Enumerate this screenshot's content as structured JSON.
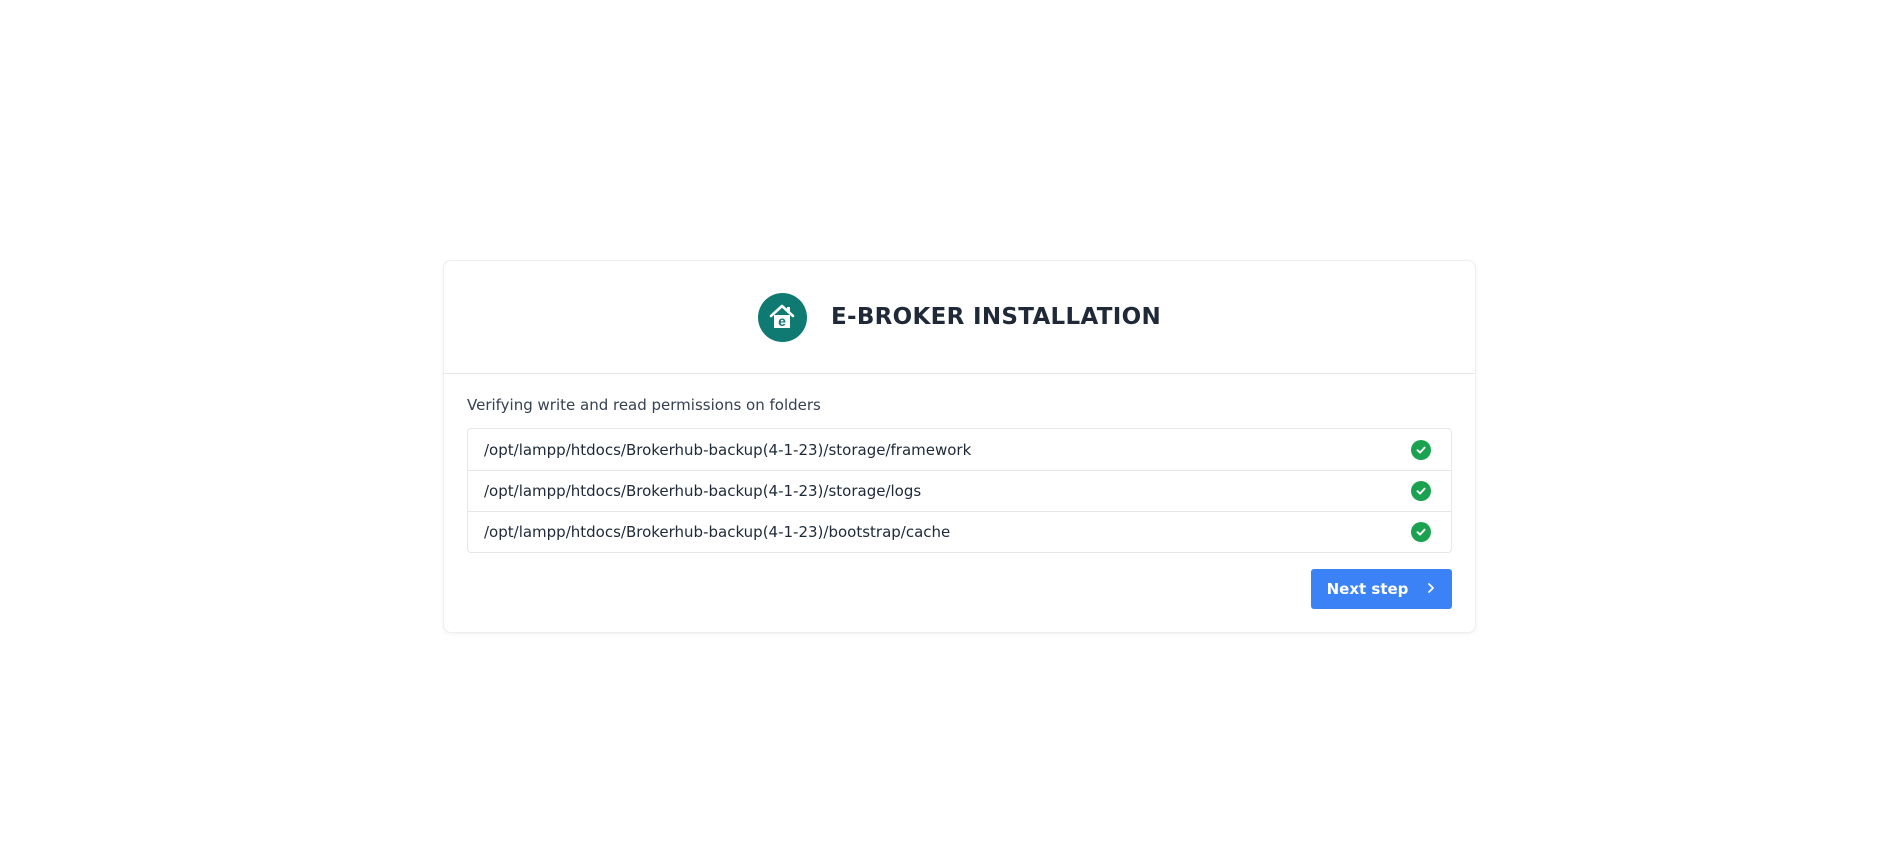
{
  "header": {
    "title": "E-BROKER INSTALLATION",
    "logo_icon": "house-e-logo-icon"
  },
  "body": {
    "subtitle": "Verifying write and read permissions on folders",
    "folders": [
      {
        "path": "/opt/lampp/htdocs/Brokerhub-backup(4-1-23)/storage/framework",
        "status_icon": "check-circle-icon"
      },
      {
        "path": "/opt/lampp/htdocs/Brokerhub-backup(4-1-23)/storage/logs",
        "status_icon": "check-circle-icon"
      },
      {
        "path": "/opt/lampp/htdocs/Brokerhub-backup(4-1-23)/bootstrap/cache",
        "status_icon": "check-circle-icon"
      }
    ]
  },
  "actions": {
    "next_label": "Next step",
    "next_icon": "chevron-right-icon"
  },
  "colors": {
    "brand": "#0f7a72",
    "success": "#1aa251",
    "primary_button": "#3b82f6"
  }
}
